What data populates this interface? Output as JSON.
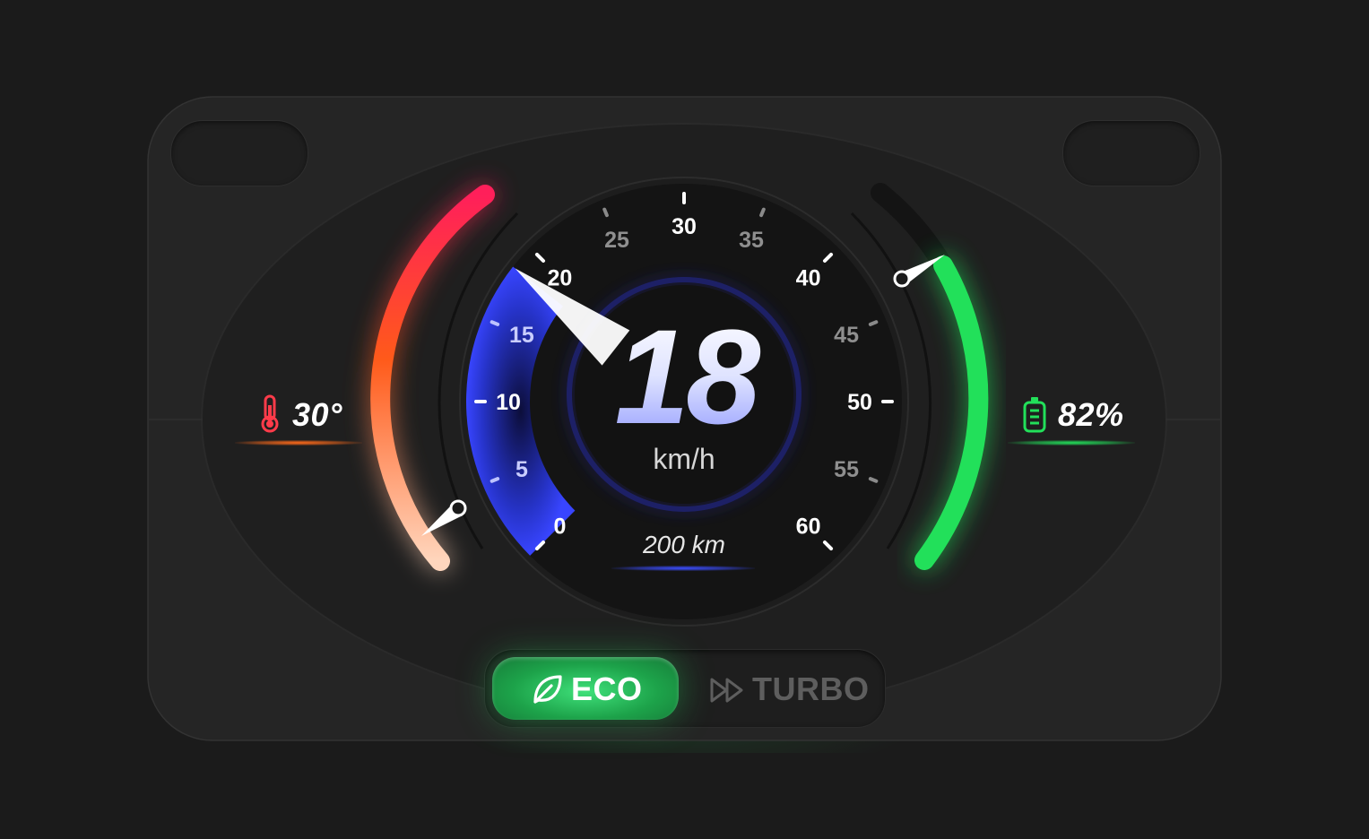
{
  "speed": {
    "value": "18",
    "unit": "km/h",
    "max": 60,
    "needle_value": 18.5
  },
  "speed_scale": {
    "labels": [
      "0",
      "5",
      "10",
      "15",
      "20",
      "25",
      "30",
      "35",
      "40",
      "45",
      "50",
      "55",
      "60"
    ]
  },
  "odometer": {
    "value": "200",
    "unit": "km"
  },
  "temperature": {
    "value": "30°",
    "gauge_level": 0.1
  },
  "battery": {
    "value": "82%",
    "level": 0.82
  },
  "headlights": {
    "low_beam": "off",
    "high_beam": "on"
  },
  "turn_signals": {
    "left": "off",
    "right": "on"
  },
  "drive_mode": {
    "options": [
      "ECO",
      "TURBO"
    ],
    "selected": "ECO"
  },
  "colors": {
    "background": "#1b1b1b",
    "panel": "#262626",
    "accent_blue": "#2f3bff",
    "speed_text": "#e8ebff",
    "battery_green": "#22e05a",
    "temp_hot": "#ff1f4b",
    "temp_mid": "#ff6a1a",
    "temp_cool": "#ffcba6",
    "signal_yellow": "#ffd400",
    "headlight_blue": "#1f4bff",
    "inactive_gray": "#4a4a4a"
  },
  "icons": [
    "low-beam-icon",
    "high-beam-icon",
    "left-arrow-icon",
    "right-arrow-icon",
    "thermometer-icon",
    "battery-icon",
    "leaf-icon",
    "fast-forward-icon"
  ]
}
